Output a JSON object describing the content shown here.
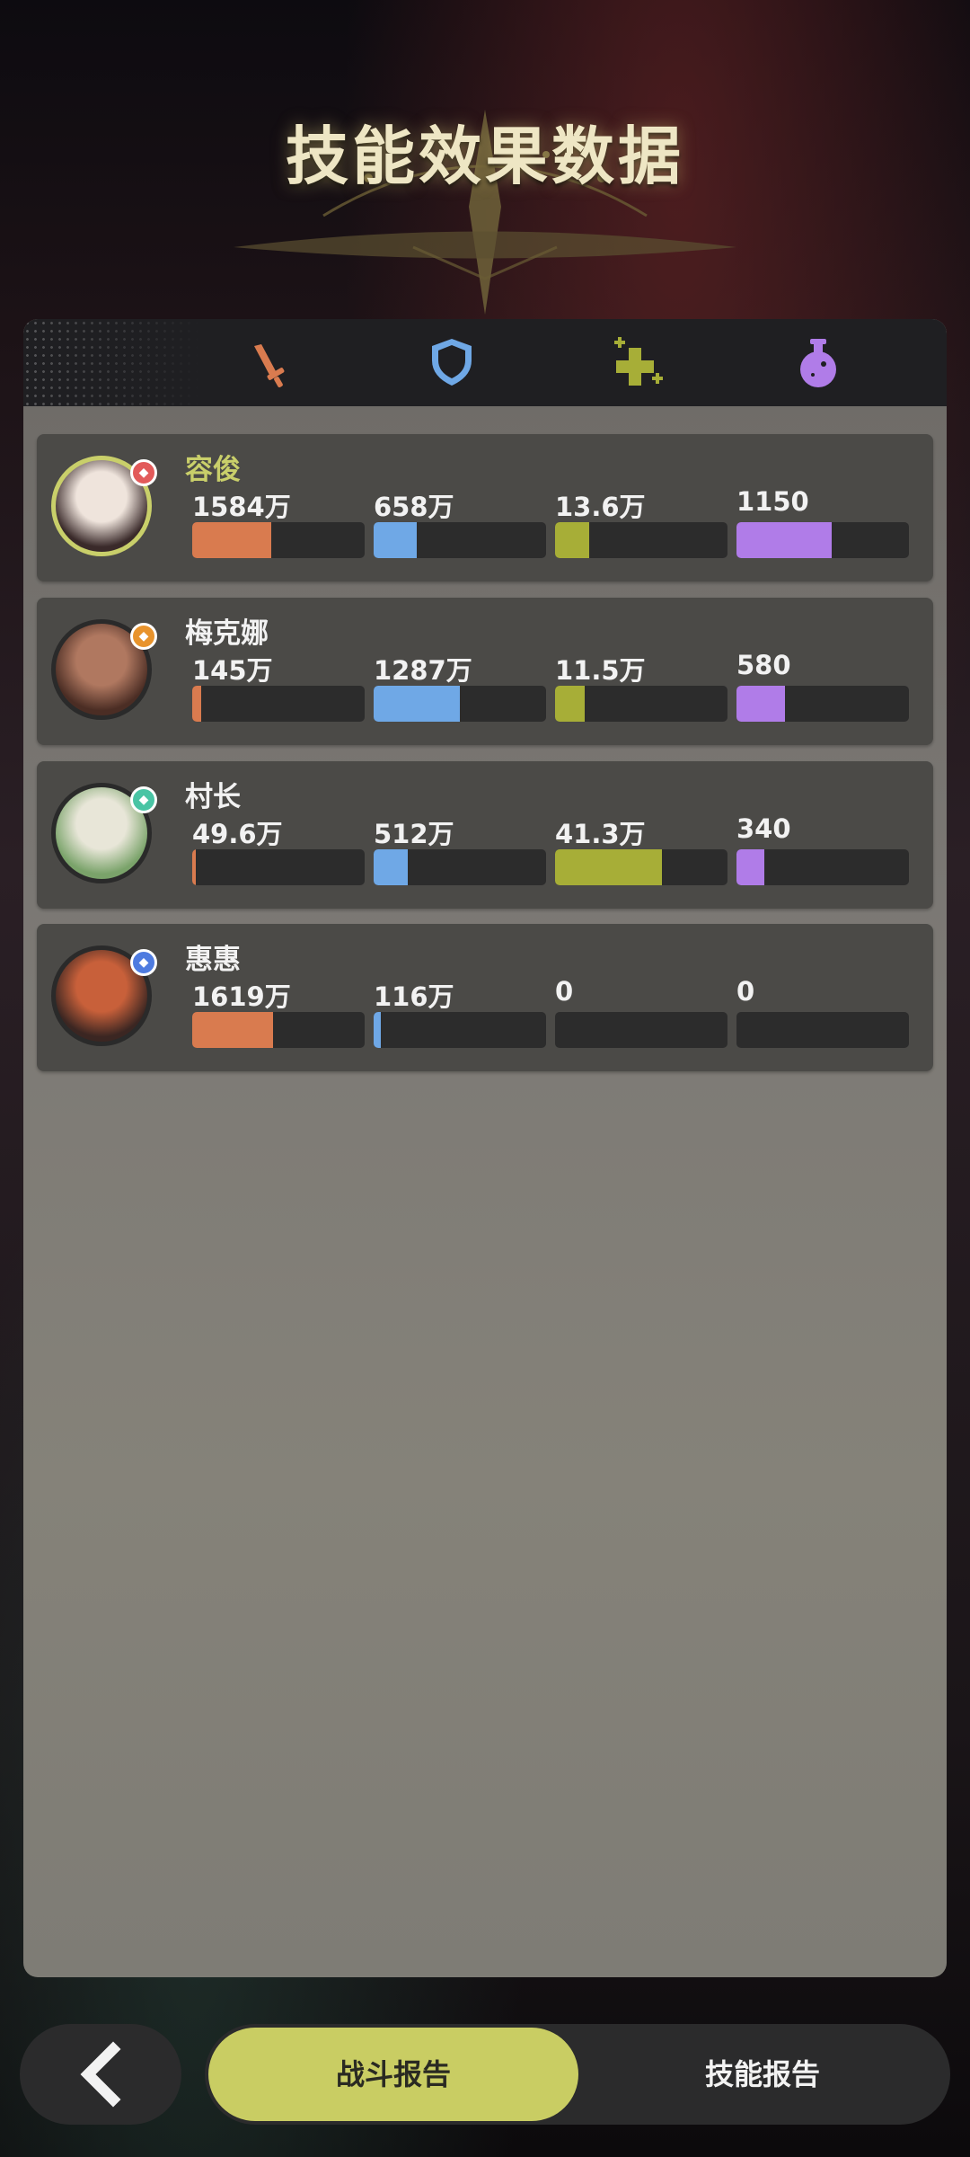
{
  "header": {
    "title": "技能效果数据"
  },
  "tabs": [
    {
      "icon": "sword-icon",
      "color": "#d97b4f"
    },
    {
      "icon": "shield-icon",
      "color": "#6fa8e6"
    },
    {
      "icon": "heal-plus-icon",
      "color": "#a7ae37"
    },
    {
      "icon": "potion-icon",
      "color": "#b07ce8"
    }
  ],
  "stat_colors": [
    "#d97b4f",
    "#6fa8e6",
    "#a7ae37",
    "#b07ce8"
  ],
  "heroes": [
    {
      "name": "容俊",
      "selected": true,
      "values": [
        "1584万",
        "658万",
        "13.6万",
        "1150"
      ],
      "fills": [
        0.46,
        0.25,
        0.2,
        0.55
      ]
    },
    {
      "name": "梅克娜",
      "selected": false,
      "values": [
        "145万",
        "1287万",
        "11.5万",
        "580"
      ],
      "fills": [
        0.05,
        0.5,
        0.17,
        0.28
      ]
    },
    {
      "name": "村长",
      "selected": false,
      "values": [
        "49.6万",
        "512万",
        "41.3万",
        "340"
      ],
      "fills": [
        0.02,
        0.2,
        0.62,
        0.16
      ]
    },
    {
      "name": "惠惠",
      "selected": false,
      "values": [
        "1619万",
        "116万",
        "0",
        "0"
      ],
      "fills": [
        0.47,
        0.04,
        0,
        0
      ]
    }
  ],
  "footer": {
    "back_icon": "chevron-left-icon",
    "battle_report": "战斗报告",
    "skill_report": "技能报告"
  }
}
